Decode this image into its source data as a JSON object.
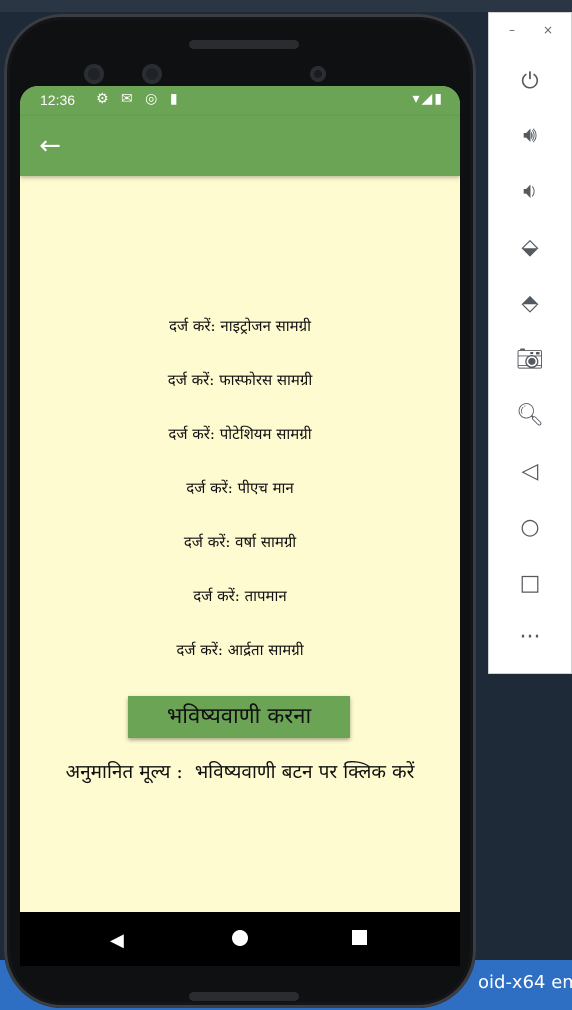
{
  "status": {
    "time": "12:36"
  },
  "form": {
    "fields": [
      "दर्ज करें: नाइट्रोजन सामग्री",
      "दर्ज करें: फास्फोरस सामग्री",
      "दर्ज करें: पोटेशियम सामग्री",
      "दर्ज करें: पीएच मान",
      "दर्ज करें: वर्षा सामग्री",
      "दर्ज करें: तापमान",
      "दर्ज करें: आर्द्रता सामग्री"
    ],
    "predict_label": "भविष्यवाणी करना"
  },
  "result": {
    "label": "अनुमानित मूल्य :",
    "value": "भविष्यवाणी बटन पर क्लिक करें"
  },
  "emulator": {
    "taskbar_text": "oid-x64 em"
  },
  "colors": {
    "appbar": "#6aa454",
    "background": "#fffbd0"
  },
  "icons": [
    "arrow-back-icon",
    "power-icon",
    "volume-up-icon",
    "volume-down-icon",
    "rotate-left-icon",
    "rotate-right-icon",
    "camera-icon",
    "zoom-in-icon",
    "nav-back-icon",
    "nav-home-icon",
    "nav-overview-icon",
    "more-icon"
  ]
}
